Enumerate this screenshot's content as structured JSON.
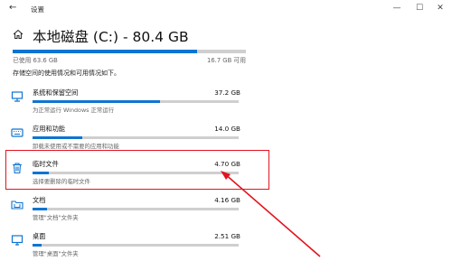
{
  "titlebar": {
    "back_icon": "arrow-left-icon",
    "title": "设置",
    "minimize_glyph": "—",
    "maximize_glyph": "☐",
    "close_glyph": "✕"
  },
  "header": {
    "home_icon": "home-icon",
    "title": "本地磁盘 (C:) - 80.4 GB"
  },
  "usage": {
    "used_label": "已使用 63.6 GB",
    "free_label": "16.7 GB 可用",
    "used_fraction": 0.79,
    "description": "存储空间的使用情况和可用情况如下。"
  },
  "accent_color": "#0f74d1",
  "highlight_color": "#e1151f",
  "categories": [
    {
      "name": "系统和保留空间",
      "size": "37.2 GB",
      "subtitle": "为正常运行 Windows 正常运行",
      "fraction": 0.62,
      "icon": "monitor-stand-icon"
    },
    {
      "name": "应用和功能",
      "size": "14.0 GB",
      "subtitle": "卸载未使用或不需要的应用和功能",
      "fraction": 0.24,
      "icon": "keyboard-icon"
    },
    {
      "name": "临时文件",
      "size": "4.70 GB",
      "subtitle": "选择要删除的临时文件",
      "fraction": 0.08,
      "icon": "trash-icon"
    },
    {
      "name": "文档",
      "size": "4.16 GB",
      "subtitle": "管理\"文档\"文件夹",
      "fraction": 0.07,
      "icon": "documents-folder-icon"
    },
    {
      "name": "桌面",
      "size": "2.51 GB",
      "subtitle": "管理\"桌面\"文件夹",
      "fraction": 0.045,
      "icon": "desktop-monitor-icon"
    }
  ]
}
